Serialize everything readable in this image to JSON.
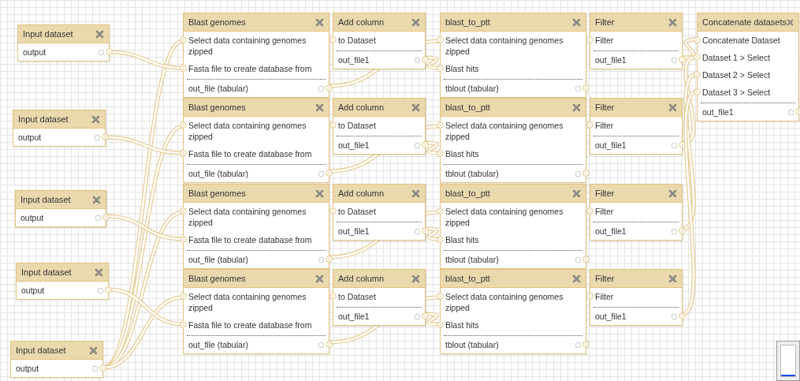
{
  "nodes": [
    {
      "kind": "input",
      "title": "Input dataset",
      "outputs": [
        "output"
      ]
    },
    {
      "kind": "input",
      "title": "Input dataset",
      "outputs": [
        "output"
      ]
    },
    {
      "kind": "input",
      "title": "Input dataset",
      "outputs": [
        "output"
      ]
    },
    {
      "kind": "input",
      "title": "Input dataset",
      "outputs": [
        "output"
      ]
    },
    {
      "kind": "input",
      "title": "Input dataset",
      "outputs": [
        "output"
      ]
    },
    {
      "kind": "tool",
      "title": "Blast genomes",
      "inputs": [
        "Select data containing genomes zipped",
        "Fasta file to create database from"
      ],
      "outputs": [
        "out_file (tabular)"
      ]
    },
    {
      "kind": "tool",
      "title": "Add column",
      "inputs": [
        "to Dataset"
      ],
      "outputs": [
        "out_file1"
      ]
    },
    {
      "kind": "tool",
      "title": "Blast genomes",
      "inputs": [
        "Select data containing genomes zipped",
        "Fasta file to create database from"
      ],
      "outputs": [
        "out_file (tabular)"
      ]
    },
    {
      "kind": "tool",
      "title": "Add column",
      "inputs": [
        "to Dataset"
      ],
      "outputs": [
        "out_file1"
      ]
    },
    {
      "kind": "tool",
      "title": "Blast genomes",
      "inputs": [
        "Select data containing genomes zipped",
        "Fasta file to create database from"
      ],
      "outputs": [
        "out_file (tabular)"
      ]
    },
    {
      "kind": "tool",
      "title": "Add column",
      "inputs": [
        "to Dataset"
      ],
      "outputs": [
        "out_file1"
      ]
    },
    {
      "kind": "tool",
      "title": "Blast genomes",
      "inputs": [
        "Select data containing genomes zipped",
        "Fasta file to create database from"
      ],
      "outputs": [
        "out_file (tabular)"
      ]
    },
    {
      "kind": "tool",
      "title": "Add column",
      "inputs": [
        "to Dataset"
      ],
      "outputs": [
        "out_file1"
      ]
    },
    {
      "kind": "tool",
      "title": "blast_to_ptt",
      "inputs": [
        "Select data containing genomes zipped",
        "Blast hits"
      ],
      "outputs": [
        "tblout (tabular)"
      ]
    },
    {
      "kind": "tool",
      "title": "Filter",
      "inputs": [
        "Filter"
      ],
      "outputs": [
        "out_file1"
      ]
    },
    {
      "kind": "tool",
      "title": "blast_to_ptt",
      "inputs": [
        "Select data containing genomes zipped",
        "Blast hits"
      ],
      "outputs": [
        "tblout (tabular)"
      ]
    },
    {
      "kind": "tool",
      "title": "Filter",
      "inputs": [
        "Filter"
      ],
      "outputs": [
        "out_file1"
      ]
    },
    {
      "kind": "tool",
      "title": "blast_to_ptt",
      "inputs": [
        "Select data containing genomes zipped",
        "Blast hits"
      ],
      "outputs": [
        "tblout (tabular)"
      ]
    },
    {
      "kind": "tool",
      "title": "Filter",
      "inputs": [
        "Filter"
      ],
      "outputs": [
        "out_file1"
      ]
    },
    {
      "kind": "tool",
      "title": "blast_to_ptt",
      "inputs": [
        "Select data containing genomes zipped",
        "Blast hits"
      ],
      "outputs": [
        "tblout (tabular)"
      ]
    },
    {
      "kind": "tool",
      "title": "Filter",
      "inputs": [
        "Filter"
      ],
      "outputs": [
        "out_file1"
      ]
    },
    {
      "kind": "tool",
      "title": "Concatenate datasets",
      "inputs": [
        "Concatenate Dataset",
        "Dataset 1 > Select",
        "Dataset 2 > Select",
        "Dataset 3 > Select"
      ],
      "outputs": [
        "out_file1"
      ]
    }
  ]
}
